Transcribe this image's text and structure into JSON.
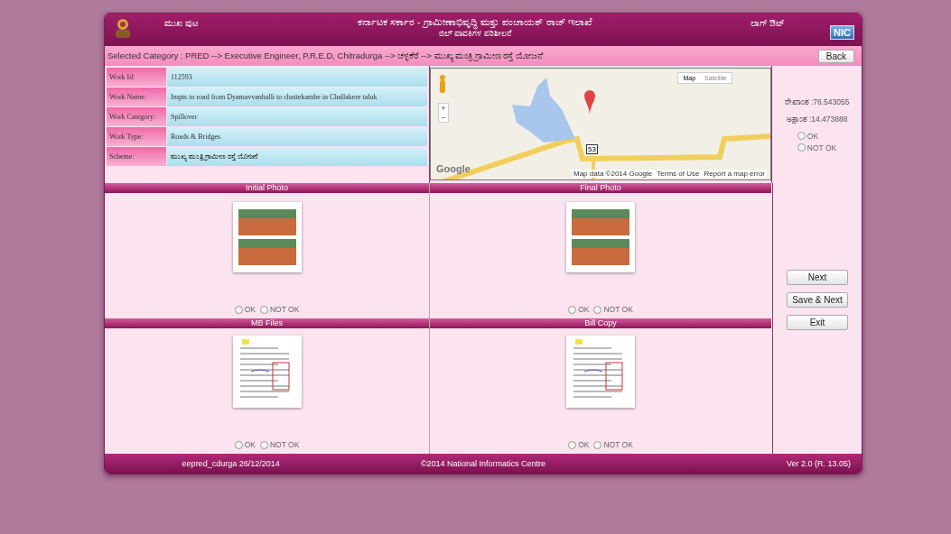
{
  "header": {
    "home_link": "ಮುಖ ಪುಟ",
    "title": "ಕರ್ನಾಟಕ ಸರ್ಕಾರ - ಗ್ರಾಮೀಣಾಭಿವೃದ್ಧಿ ಮತ್ತು ಪಂಚಾಯತ್ ರಾಜ್ ಇಲಾಖೆ",
    "subtitle": "ಬಿಲ್ ಪಾವತಿಗಳ ಪರಿಶೀಲನೆ",
    "logout_link": "ಲಾಗ್ ಔಟ್",
    "nic_logo": "NIC"
  },
  "category_bar": {
    "text": "Selected Category : PRED --> Executive Engineer, P.R.E.D, Chitradurga --> ಚಳ್ಳಕೆರೆ --> ಮುಖ್ಯ ಮಂತ್ರಿ ಗ್ರಾಮೀಣ ರಸ್ತೆ ಯೋಜನೆ",
    "back_button": "Back"
  },
  "work_details": [
    {
      "label": "Work Id:",
      "value": "112593"
    },
    {
      "label": "Work Name:",
      "value": "Impts to road from Dyamavvanhalli to chattekambe in Challakere taluk"
    },
    {
      "label": "Work Category:",
      "value": "Spillover"
    },
    {
      "label": "Work Type:",
      "value": "Roads & Bridges"
    },
    {
      "label": "Scheme:",
      "value": "ಮುಖ್ಯ ಮಂತ್ರಿ ಗ್ರಾಮೀಣ ರಸ್ತೆ ಯೋಜನೆ"
    }
  ],
  "map": {
    "map_tab": "Map",
    "satellite_tab": "Satellite",
    "zoom_in": "+",
    "zoom_out": "−",
    "road_shield": "53",
    "brand": "Google",
    "attribution": "Map data ©2014 Google",
    "terms_link": "Terms of Use",
    "report_link": "Report a map error"
  },
  "location": {
    "longitude": "ರೇಖಾಂಶ :76.543055",
    "latitude": "ಅಕ್ಷಾಂಶ :14.473888",
    "options": [
      {
        "label": "OK",
        "selected": false
      },
      {
        "label": "NOT OK",
        "selected": false
      }
    ]
  },
  "sections": [
    {
      "title": "Initial Photo",
      "kind": "photo",
      "options": [
        {
          "label": "OK",
          "selected": false
        },
        {
          "label": "NOT OK",
          "selected": false
        }
      ]
    },
    {
      "title": "Final Photo",
      "kind": "photo",
      "options": [
        {
          "label": "OK",
          "selected": false
        },
        {
          "label": "NOT OK",
          "selected": false
        }
      ]
    },
    {
      "title": "MB Files",
      "kind": "document",
      "options": [
        {
          "label": "OK",
          "selected": false
        },
        {
          "label": "NOT OK",
          "selected": false
        }
      ]
    },
    {
      "title": "Bill Copy",
      "kind": "document",
      "options": [
        {
          "label": "OK",
          "selected": false
        },
        {
          "label": "NOT OK",
          "selected": false
        }
      ]
    }
  ],
  "buttons": [
    "Next",
    "Save & Next",
    "Exit"
  ],
  "footer": {
    "user": "eepred_cdurga 26/12/2014",
    "copyright": "©2014 National Informatics Centre",
    "version": "Ver 2.0 (R. 13.05)"
  }
}
